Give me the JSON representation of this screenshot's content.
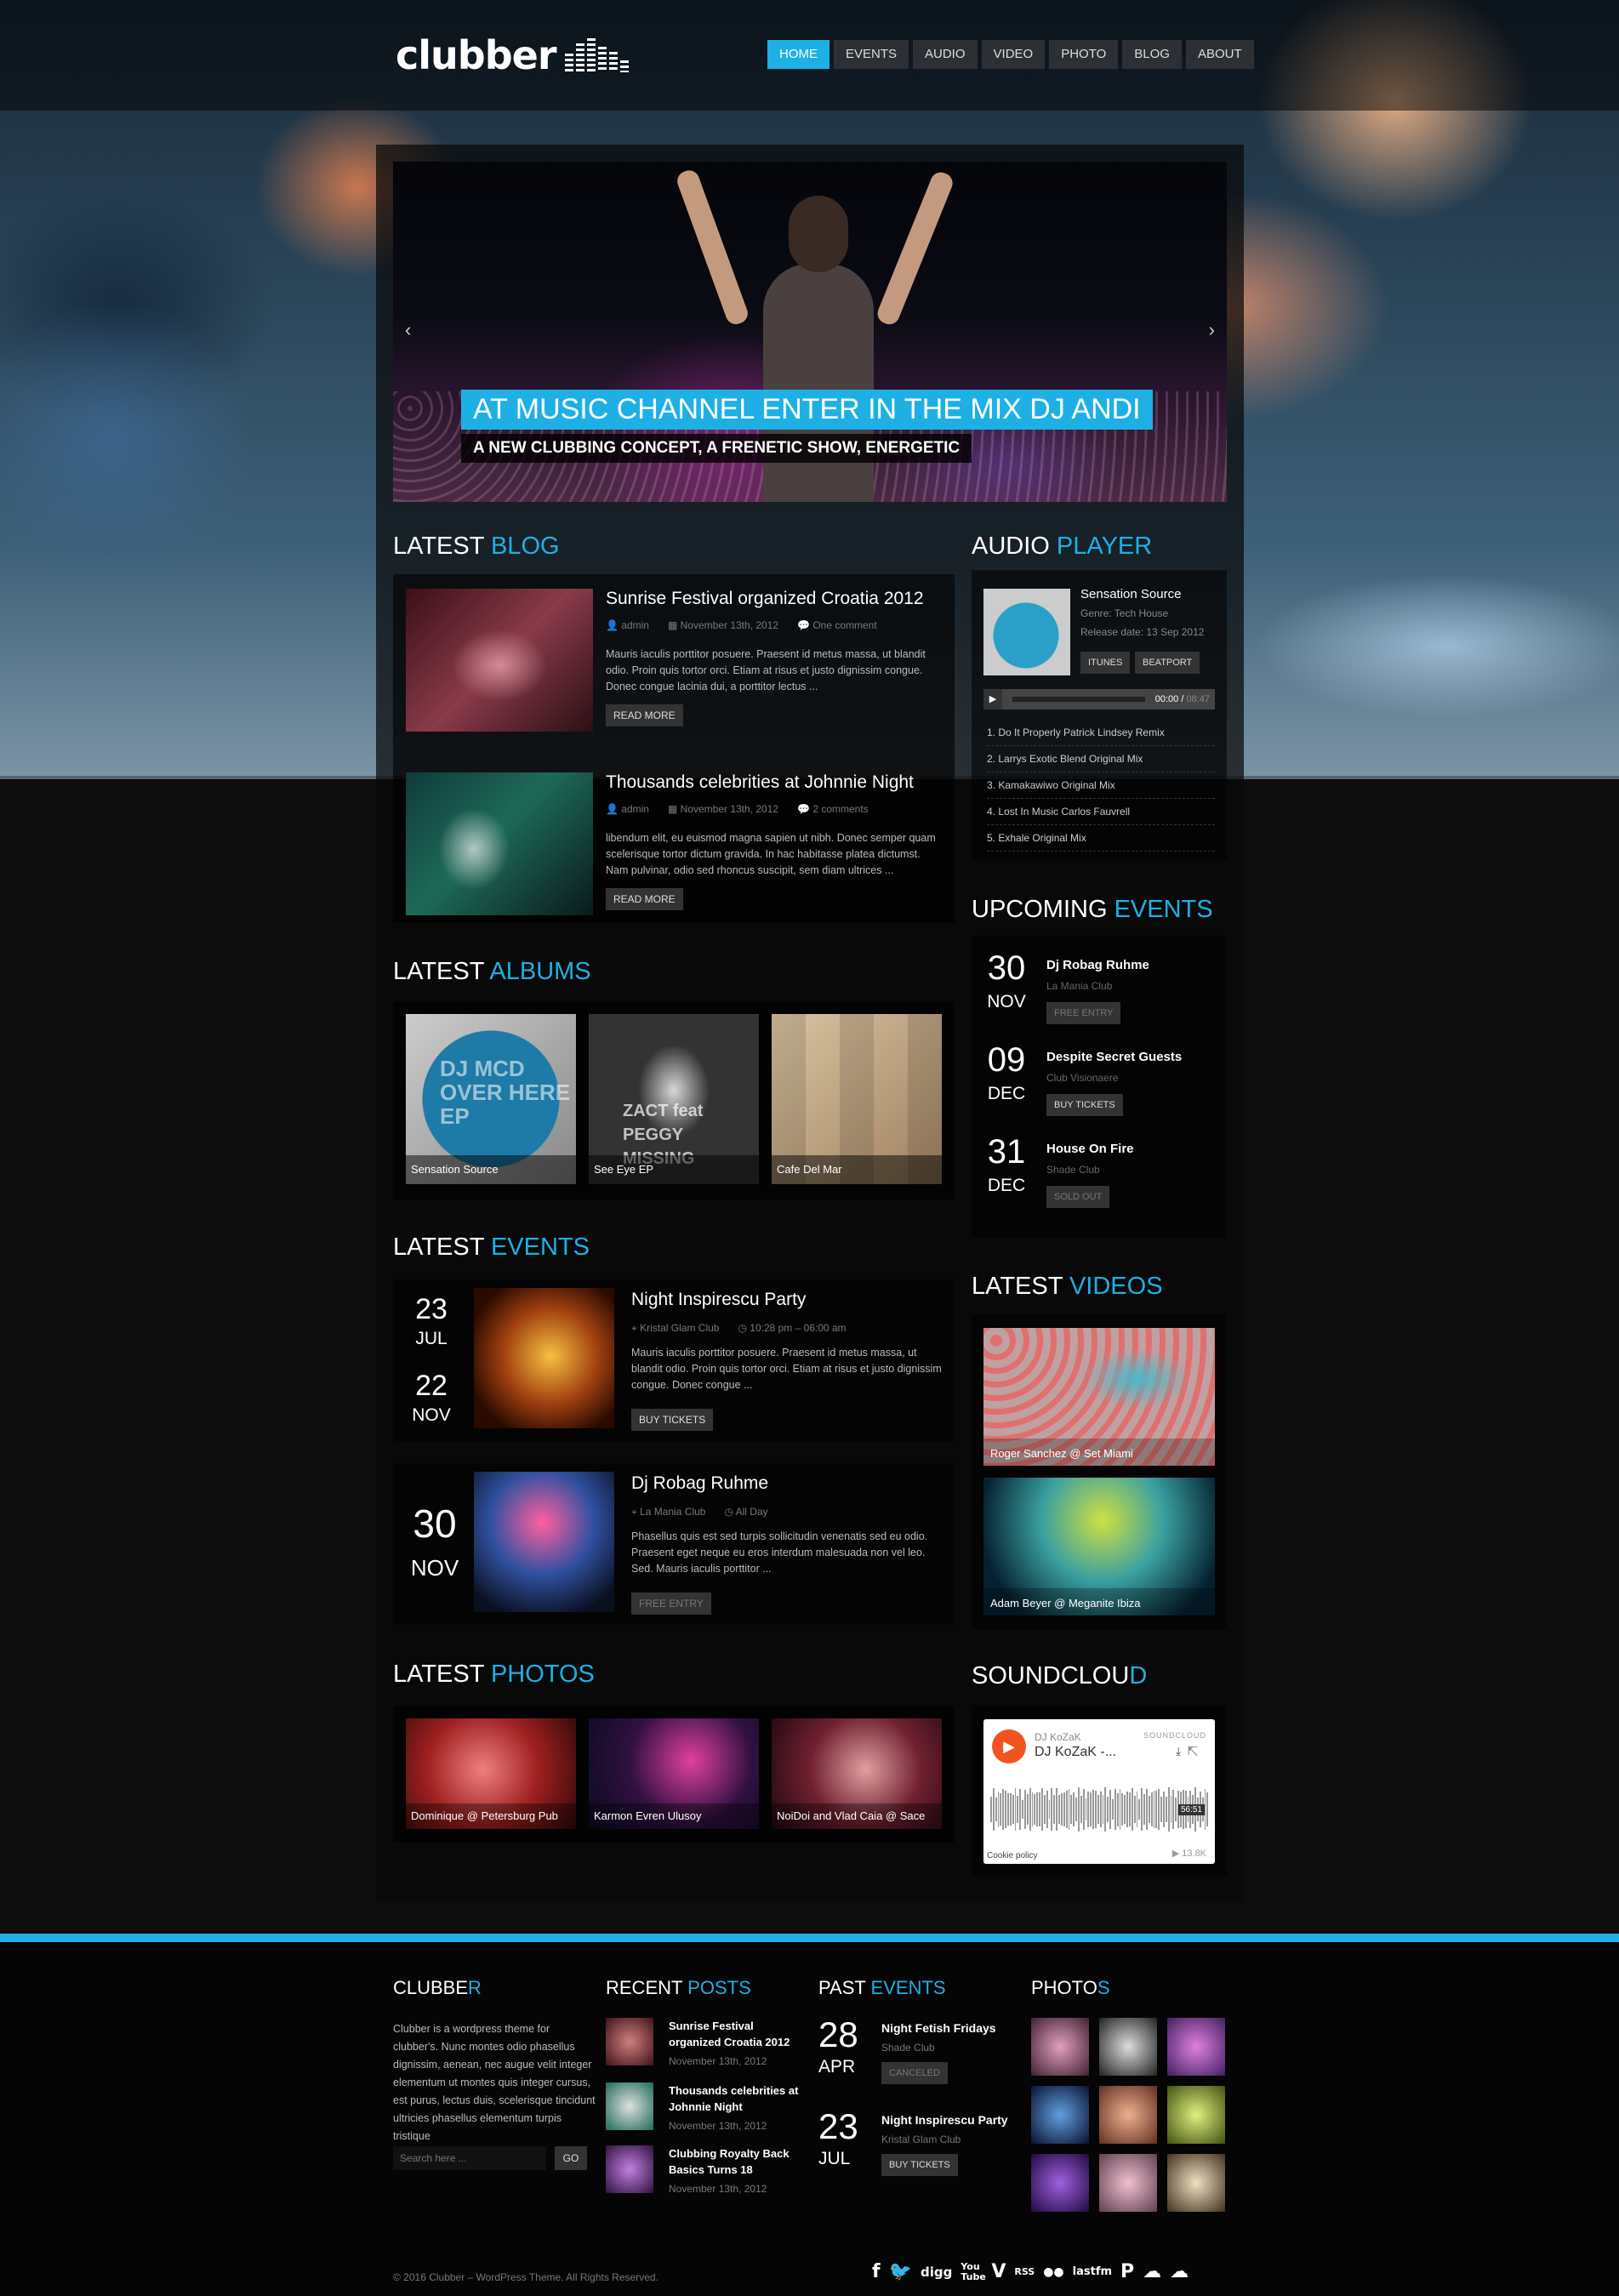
{
  "header": {
    "logo": "clubber",
    "nav": [
      {
        "label": "HOME",
        "active": true
      },
      {
        "label": "EVENTS"
      },
      {
        "label": "AUDIO"
      },
      {
        "label": "VIDEO"
      },
      {
        "label": "PHOTO"
      },
      {
        "label": "BLOG"
      },
      {
        "label": "ABOUT"
      }
    ]
  },
  "slider": {
    "title": "AT MUSIC CHANNEL ENTER IN THE MIX DJ ANDI",
    "subtitle": "A NEW CLUBBING CONCEPT, A FRENETIC SHOW, ENERGETIC",
    "prev": "‹",
    "next": "›"
  },
  "blog": {
    "title_a": "LATEST ",
    "title_b": "BLOG",
    "items": [
      {
        "title": "Sunrise Festival organized Croatia 2012",
        "author": "admin",
        "date": "November 13th, 2012",
        "comments": "One comment",
        "text": "Mauris iaculis porttitor posuere. Praesent id metus massa, ut blandit odio. Proin quis tortor orci. Etiam at risus et justo dignissim congue. Donec congue lacinia dui, a porttitor lectus ...",
        "button": "READ MORE"
      },
      {
        "title": "Thousands celebrities at Johnnie Night",
        "author": "admin",
        "date": "November 13th, 2012",
        "comments": "2 comments",
        "text": "libendum elit, eu euismod magna sapien ut nibh. Donec semper quam scelerisque tortor dictum gravida. In hac habitasse platea dictumst. Nam pulvinar, odio sed rhoncus suscipit, sem diam ultrices ...",
        "button": "READ MORE"
      }
    ]
  },
  "albums": {
    "title_a": "LATEST ",
    "title_b": "ALBUMS",
    "items": [
      {
        "caption": "Sensation Source",
        "art_text": "DJ MCD OVER HERE EP"
      },
      {
        "caption": "See Eye EP",
        "art_text": "ZACT feat PEGGY MISSING"
      },
      {
        "caption": "Cafe Del Mar",
        "art_text": ""
      }
    ]
  },
  "events": {
    "title_a": "LATEST ",
    "title_b": "EVENTS",
    "items": [
      {
        "day": "23",
        "month": "JUL",
        "day2": "22",
        "month2": "NOV",
        "title": "Night Inspirescu Party",
        "venue": "Kristal Glam Club",
        "time": "10:28 pm – 06:00 am",
        "text": "Mauris iaculis porttitor posuere. Praesent id metus massa, ut blandit odio. Proin quis tortor orci. Etiam at risus et justo dignissim congue. Donec congue ...",
        "button": "BUY TICKETS"
      },
      {
        "day": "30",
        "month": "NOV",
        "title": "Dj Robag Ruhme",
        "venue": "La Mania Club",
        "time": "All Day",
        "text": "Phasellus quis est sed turpis sollicitudin venenatis sed eu odio. Praesent eget neque eu eros interdum malesuada non vel leo. Sed. Mauris iaculis porttitor ...",
        "button": "FREE ENTRY"
      }
    ]
  },
  "photos": {
    "title_a": "LATEST ",
    "title_b": "PHOTOS",
    "items": [
      {
        "caption": "Dominique @ Petersburg Pub"
      },
      {
        "caption": "Karmon Evren Ulusoy"
      },
      {
        "caption": "NoiDoi and Vlad Caia @ Sace"
      }
    ]
  },
  "audio": {
    "title_a": "AUDIO ",
    "title_b": "PLAYER",
    "album_title": "Sensation Source",
    "genre": "Genre: Tech House",
    "release": "Release date: 13 Sep 2012",
    "btn_itunes": "ITUNES",
    "btn_beatport": "BEATPORT",
    "time_current": "00:00",
    "time_total": "08:47",
    "tracks": [
      "1. Do It Properly Patrick Lindsey Remix",
      "2. Larrys Exotic Blend Original Mix",
      "3. Kamakawiwo Original Mix",
      "4. Lost In Music Carlos Fauvrell",
      "5. Exhale Original Mix"
    ]
  },
  "upcoming": {
    "title_a": "UPCOMING ",
    "title_b": "EVENTS",
    "items": [
      {
        "day": "30",
        "month": "NOV",
        "title": "Dj Robag Ruhme",
        "venue": "La Mania Club",
        "status": "FREE ENTRY"
      },
      {
        "day": "09",
        "month": "DEC",
        "title": "Despite Secret Guests",
        "venue": "Club Visionaere",
        "status": "BUY TICKETS"
      },
      {
        "day": "31",
        "month": "DEC",
        "title": "House On Fire",
        "venue": "Shade Club",
        "status": "SOLD OUT"
      }
    ]
  },
  "videos": {
    "title_a": "LATEST ",
    "title_b": "VIDEOS",
    "items": [
      {
        "caption": "Roger Sanchez @ Set Miami"
      },
      {
        "caption": "Adam Beyer @ Meganite Ibiza"
      }
    ]
  },
  "soundcloud": {
    "title_a": "SOUNDCLOU",
    "title_b": "D",
    "user": "DJ KoZaK",
    "track": "DJ KoZaK -...",
    "brand": "SOUNDCLOUD",
    "duration": "56:51",
    "cookie": "Cookie policy",
    "plays": "▶ 13.8K"
  },
  "footer": {
    "about_title_a": "CLUBBE",
    "about_title_b": "R",
    "about_text": "Clubber is a wordpress theme for clubber's. Nunc montes odio phasellus dignissim, aenean, nec augue velit integer elementum ut montes quis integer cursus, est purus, lectus duis, scelerisque tincidunt ultricies phasellus elementum turpis tristique",
    "search_placeholder": "Search here ...",
    "search_button": "GO",
    "posts_title_a": "RECENT ",
    "posts_title_b": "POSTS",
    "posts": [
      {
        "title": "Sunrise Festival organized Croatia 2012",
        "date": "November 13th, 2012"
      },
      {
        "title": "Thousands celebrities at Johnnie Night",
        "date": "November 13th, 2012"
      },
      {
        "title": "Clubbing Royalty Back Basics Turns 18",
        "date": "November 13th, 2012"
      }
    ],
    "past_title_a": "PAST ",
    "past_title_b": "EVENTS",
    "past": [
      {
        "day": "28",
        "month": "APR",
        "title": "Night Fetish Fridays",
        "venue": "Shade Club",
        "status": "CANCELED"
      },
      {
        "day": "23",
        "month": "JUL",
        "title": "Night Inspirescu Party",
        "venue": "Kristal Glam Club",
        "status": "BUY TICKETS"
      }
    ],
    "photos_title_a": "PHOTO",
    "photos_title_b": "S",
    "copyright": "© 2016 Clubber – WordPress Theme. All Rights Reserved.",
    "social": [
      "f",
      "🐦",
      "digg",
      "You Tube",
      "V",
      "RSS",
      "●●",
      "lastfm",
      "P",
      "☁",
      "☁"
    ]
  },
  "colors": {
    "accent": "#1eb0e4"
  }
}
